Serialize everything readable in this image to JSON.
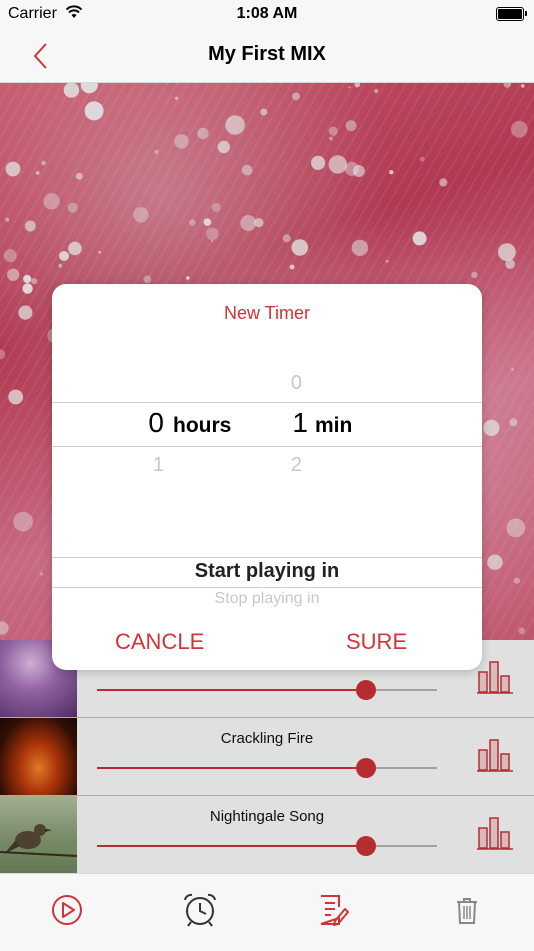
{
  "status_bar": {
    "carrier": "Carrier",
    "time": "1:08 AM"
  },
  "nav": {
    "title": "My First MIX",
    "back_icon": "chevron-left-icon"
  },
  "sounds": [
    {
      "name": "",
      "volume": 0.79,
      "thumb": "purple-sparkle"
    },
    {
      "name": "Crackling Fire",
      "volume": 0.79,
      "thumb": "fire"
    },
    {
      "name": "Nightingale Song",
      "volume": 0.79,
      "thumb": "bird"
    }
  ],
  "timer_dialog": {
    "title": "New Timer",
    "hours": {
      "above": "",
      "selected": "0",
      "below": "1",
      "unit": "hours"
    },
    "minutes": {
      "above": "0",
      "selected": "1",
      "below": "2",
      "unit": "min"
    },
    "modes": {
      "selected": "Start playing in",
      "next": "Stop playing in"
    },
    "cancel_label": "CANCLE",
    "confirm_label": "SURE"
  },
  "tabbar": {
    "icons": [
      "play-icon",
      "alarm-clock-icon",
      "edit-list-icon",
      "trash-icon"
    ]
  },
  "colors": {
    "accent": "#d03438",
    "bar_bg": "#f7f7f7",
    "slider_track": "#b8b8b8"
  }
}
